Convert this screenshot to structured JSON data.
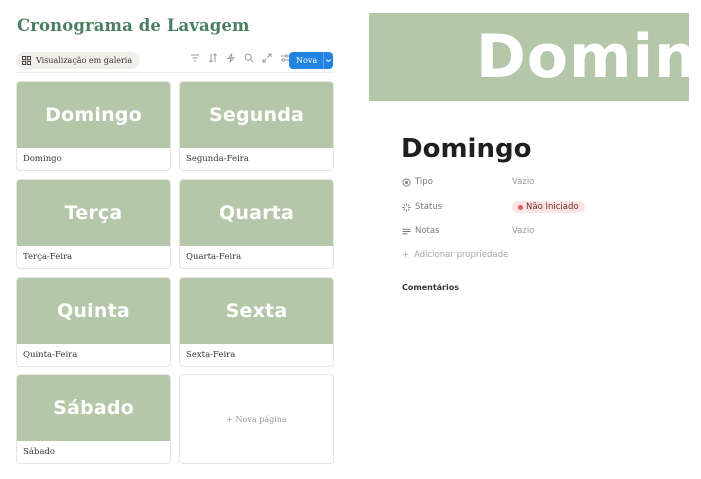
{
  "database": {
    "title": "Cronograma de Lavagem",
    "view_label": "Visualização em galeria",
    "new_button_label": "Nova",
    "cards": [
      {
        "cover_text": "Domingo",
        "name": "Domingo"
      },
      {
        "cover_text": "Segunda",
        "name": "Segunda-Feira"
      },
      {
        "cover_text": "Terça",
        "name": "Terça-Feira"
      },
      {
        "cover_text": "Quarta",
        "name": "Quarta-Feira"
      },
      {
        "cover_text": "Quinta",
        "name": "Quinta-Feira"
      },
      {
        "cover_text": "Sexta",
        "name": "Sexta-Feira"
      },
      {
        "cover_text": "Sábado",
        "name": "Sábado"
      }
    ],
    "new_page_label": "+ Nova página",
    "cover_color": "#b5c7a9"
  },
  "page": {
    "banner_text": "Domin",
    "title": "Domingo",
    "properties": [
      {
        "icon": "circle-dot-icon",
        "label": "Tipo",
        "value": "Vazio"
      },
      {
        "icon": "status-loader-icon",
        "label": "Status",
        "value": "Não Iniciado"
      },
      {
        "icon": "text-lines-icon",
        "label": "Notas",
        "value": "Vazio"
      }
    ],
    "add_property_label": "Adicionar propriedade",
    "comments_label": "Comentários"
  },
  "colors": {
    "accent": "#2383e2",
    "title_green": "#4a7f62",
    "status_badge_bg": "#fbe4e4",
    "status_dot": "#e55a5a"
  }
}
